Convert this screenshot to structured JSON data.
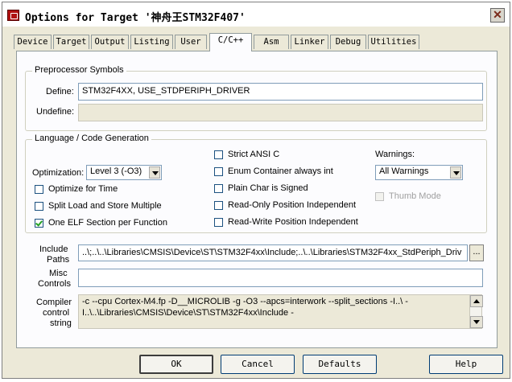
{
  "window": {
    "title": "Options for Target '神舟王STM32F407'",
    "close_glyph": "✕"
  },
  "tabs": [
    {
      "label": "Device"
    },
    {
      "label": "Target"
    },
    {
      "label": "Output"
    },
    {
      "label": "Listing"
    },
    {
      "label": "User"
    },
    {
      "label": "C/C++",
      "active": true
    },
    {
      "label": "Asm"
    },
    {
      "label": "Linker"
    },
    {
      "label": "Debug"
    },
    {
      "label": "Utilities"
    }
  ],
  "preprocessor": {
    "legend": "Preprocessor Symbols",
    "define_label": "Define:",
    "define_value": "STM32F4XX, USE_STDPERIPH_DRIVER",
    "undefine_label": "Undefine:",
    "undefine_value": ""
  },
  "codegen": {
    "legend": "Language / Code Generation",
    "optimization_label": "Optimization:",
    "optimization_value": "Level 3 (-O3)",
    "options": [
      {
        "label": "Optimize for Time",
        "checked": false
      },
      {
        "label": "Split Load and Store Multiple",
        "checked": false
      },
      {
        "label": "One ELF Section per Function",
        "checked": true
      }
    ],
    "options_mid": [
      {
        "label": "Strict ANSI C",
        "checked": false
      },
      {
        "label": "Enum Container always int",
        "checked": false
      },
      {
        "label": "Plain Char is Signed",
        "checked": false
      },
      {
        "label": "Read-Only Position Independent",
        "checked": false
      },
      {
        "label": "Read-Write Position Independent",
        "checked": false
      }
    ],
    "warnings_label": "Warnings:",
    "warnings_value": "All Warnings",
    "thumb_mode_label": "Thumb Mode"
  },
  "include": {
    "label_line1": "Include",
    "label_line2": "Paths",
    "value": "..\\;..\\..\\Libraries\\CMSIS\\Device\\ST\\STM32F4xx\\Include;..\\..\\Libraries\\STM32F4xx_StdPeriph_Driv",
    "browse_label": "..."
  },
  "misc": {
    "label_line1": "Misc",
    "label_line2": "Controls",
    "value": ""
  },
  "compiler": {
    "label_line1": "Compiler",
    "label_line2": "control",
    "label_line3": "string",
    "value": "-c --cpu Cortex-M4.fp -D__MICROLIB -g -O3 --apcs=interwork --split_sections -I..\\ -I..\\..\\Libraries\\CMSIS\\Device\\ST\\STM32F4xx\\Include -"
  },
  "buttons": {
    "ok": "OK",
    "cancel": "Cancel",
    "defaults": "Defaults",
    "help": "Help"
  }
}
